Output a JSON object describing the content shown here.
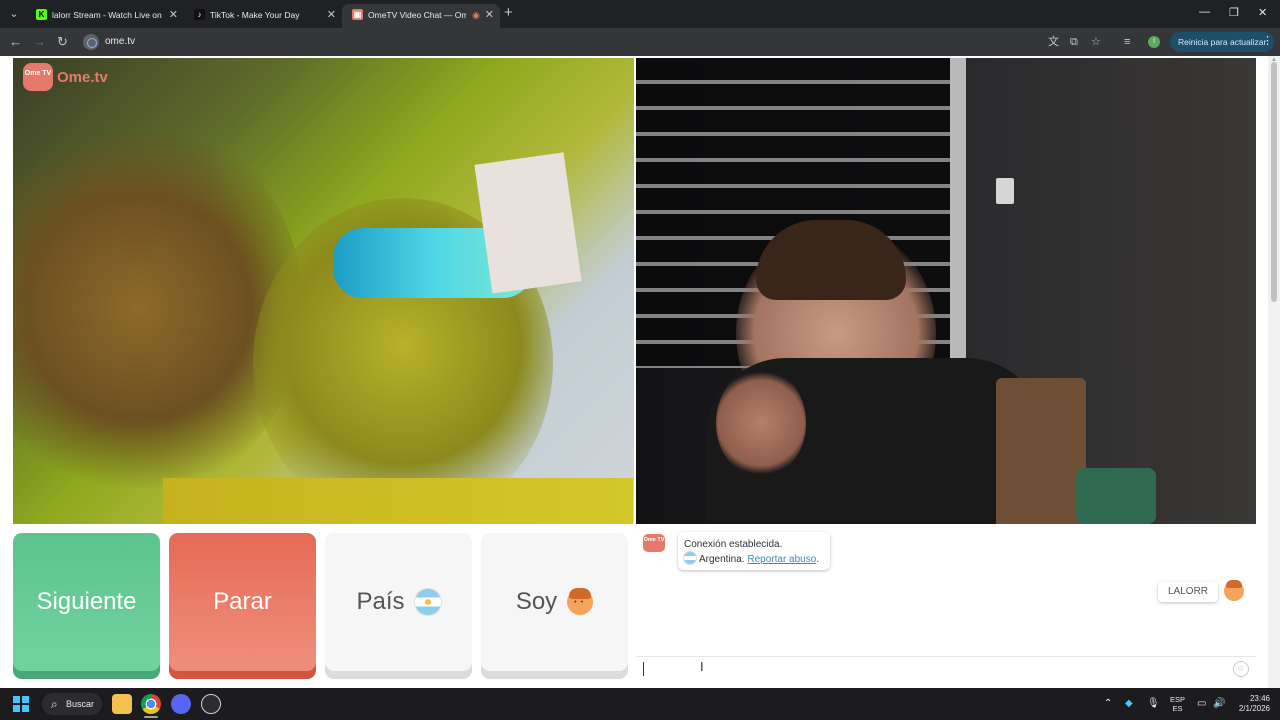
{
  "browser": {
    "tabs": [
      {
        "title": "lalorr Stream - Watch Live on K",
        "favicon": "K",
        "favicon_color": "#53fc18"
      },
      {
        "title": "TikTok - Make Your Day",
        "favicon": "♪",
        "favicon_color": "#000000"
      },
      {
        "title": "OmeTV Video Chat — Ome",
        "favicon": "▣",
        "favicon_color": "#e57a6b"
      }
    ],
    "url": "ome.tv",
    "update_button": "Reinicia para actualizar",
    "profile_initial": "I"
  },
  "ometv": {
    "logo_badge": "Ome TV",
    "logo_text": "Ome.tv",
    "buttons": {
      "next": "Siguiente",
      "stop": "Parar",
      "country": "País",
      "gender": "Soy"
    },
    "colors": {
      "next": "#5cc38d",
      "stop": "#e66a55",
      "brand": "#e57a6b"
    },
    "chat": {
      "system_logo": "Ome TV",
      "connection_message": "Conexión establecida.",
      "country": "Argentina.",
      "report_link": "Reportar abuso",
      "report_suffix": ".",
      "user_name": "LALORR"
    }
  },
  "taskbar": {
    "search_label": "Buscar",
    "language_top": "ESP",
    "language_bottom": "ES",
    "time": "23:46",
    "date": "2/1/2026"
  }
}
